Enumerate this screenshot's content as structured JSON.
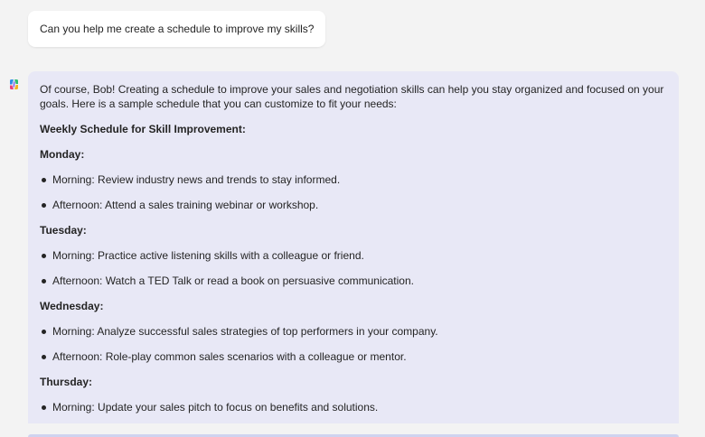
{
  "user_message": {
    "text": "Can you help me create a schedule to improve my skills?"
  },
  "bot_message": {
    "avatar_icon": "copilot-logo-icon",
    "intro": "Of course, Bob! Creating a schedule to improve your sales and negotiation skills can help you stay organized and focused on your goals. Here is a sample schedule that you can customize to fit your needs:",
    "heading": "Weekly Schedule for Skill Improvement:",
    "days": [
      {
        "name": "Monday:",
        "items": [
          "Morning: Review industry news and trends to stay informed.",
          "Afternoon: Attend a sales training webinar or workshop."
        ]
      },
      {
        "name": "Tuesday:",
        "items": [
          "Morning: Practice active listening skills with a colleague or friend.",
          "Afternoon: Watch a TED Talk or read a book on persuasive communication."
        ]
      },
      {
        "name": "Wednesday:",
        "items": [
          "Morning: Analyze successful sales strategies of top performers in your company.",
          "Afternoon: Role-play common sales scenarios with a colleague or mentor."
        ]
      },
      {
        "name": "Thursday:",
        "items": [
          "Morning: Update your sales pitch to focus on benefits and solutions."
        ]
      }
    ]
  },
  "colors": {
    "page_background": "#f3f3f3",
    "user_bubble": "#ffffff",
    "bot_bubble": "#e8e8f6"
  }
}
